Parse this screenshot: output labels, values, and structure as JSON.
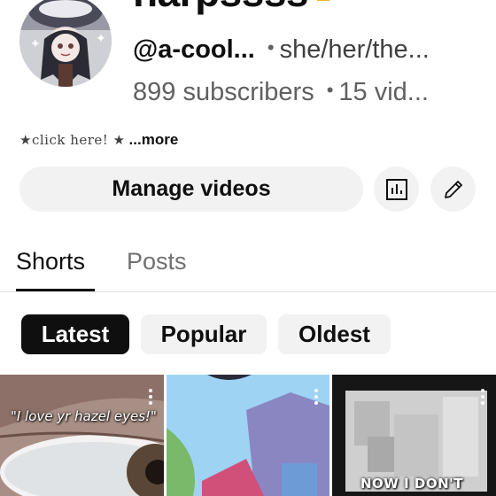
{
  "channel": {
    "name": "harpssss",
    "handle": "@a-cool...",
    "pronouns": "she/her/the...",
    "subscribers": "899 subscribers",
    "videos": "15 vid...",
    "separator": "•",
    "description_text": "★click here! ★",
    "more_label": "...more"
  },
  "actions": {
    "manage_label": "Manage videos",
    "analytics_icon": "analytics-icon",
    "edit_icon": "pencil-icon"
  },
  "tabs": [
    {
      "label": "Shorts",
      "selected": true
    },
    {
      "label": "Posts",
      "selected": false
    }
  ],
  "chips": [
    {
      "label": "Latest",
      "selected": true
    },
    {
      "label": "Popular",
      "selected": false
    },
    {
      "label": "Oldest",
      "selected": false
    }
  ],
  "shorts": [
    {
      "caption": "\"I love yr hazel eyes!\""
    },
    {
      "caption": ""
    },
    {
      "caption": "NOW I DON'T"
    }
  ],
  "colors": {
    "text_primary": "#0f0f0f",
    "text_secondary": "#606060",
    "chip_bg": "#f2f2f2",
    "chip_selected_bg": "#0f0f0f",
    "crown_gold": "#e8b92c"
  }
}
